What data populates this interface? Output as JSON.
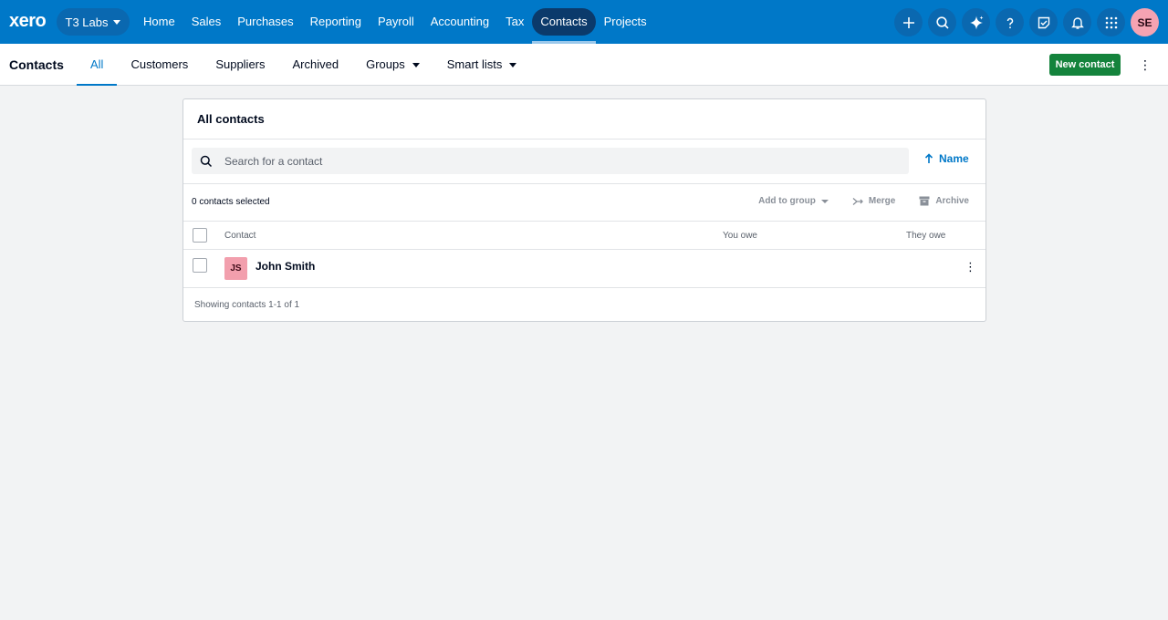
{
  "topnav": {
    "logo": "xero",
    "org": "T3 Labs",
    "links": [
      "Home",
      "Sales",
      "Purchases",
      "Reporting",
      "Payroll",
      "Accounting",
      "Tax",
      "Contacts",
      "Projects"
    ],
    "active_link": "Contacts",
    "icons": [
      "plus-icon",
      "search-icon",
      "sparkle-icon",
      "help-icon",
      "notes-icon",
      "bell-icon",
      "apps-grid-icon"
    ],
    "user_initials": "SE"
  },
  "subnav": {
    "title": "Contacts",
    "tabs": [
      {
        "label": "All",
        "active": true,
        "dropdown": false
      },
      {
        "label": "Customers",
        "active": false,
        "dropdown": false
      },
      {
        "label": "Suppliers",
        "active": false,
        "dropdown": false
      },
      {
        "label": "Archived",
        "active": false,
        "dropdown": false
      },
      {
        "label": "Groups",
        "active": false,
        "dropdown": true
      },
      {
        "label": "Smart lists",
        "active": false,
        "dropdown": true
      }
    ],
    "new_contact_label": "New contact"
  },
  "card": {
    "title": "All contacts",
    "search_placeholder": "Search for a contact",
    "sort_label": "Name",
    "selected_count": "0 contacts selected",
    "actions": {
      "add_to_group": "Add to group",
      "merge": "Merge",
      "archive": "Archive"
    },
    "columns": {
      "contact": "Contact",
      "you_owe": "You owe",
      "they_owe": "They owe"
    },
    "rows": [
      {
        "initials": "JS",
        "name": "John Smith",
        "you_owe": "",
        "they_owe": ""
      }
    ],
    "footer": "Showing contacts 1-1 of 1"
  },
  "colors": {
    "brand_blue": "#0078c8",
    "active_nav": "#0b3a6b",
    "primary_green": "#14833c",
    "avatar_pink": "#f29fad"
  }
}
